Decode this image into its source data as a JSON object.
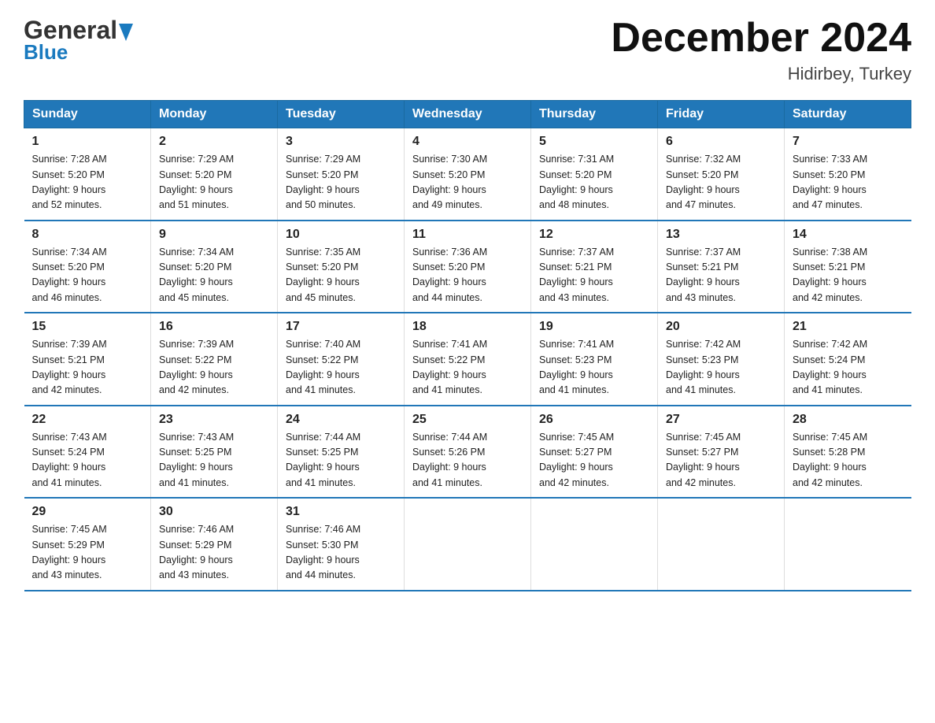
{
  "header": {
    "logo_general": "General",
    "logo_blue": "Blue",
    "month_title": "December 2024",
    "location": "Hidirbey, Turkey"
  },
  "days_of_week": [
    "Sunday",
    "Monday",
    "Tuesday",
    "Wednesday",
    "Thursday",
    "Friday",
    "Saturday"
  ],
  "weeks": [
    [
      {
        "day": "1",
        "sunrise": "7:28 AM",
        "sunset": "5:20 PM",
        "daylight": "9 hours and 52 minutes."
      },
      {
        "day": "2",
        "sunrise": "7:29 AM",
        "sunset": "5:20 PM",
        "daylight": "9 hours and 51 minutes."
      },
      {
        "day": "3",
        "sunrise": "7:29 AM",
        "sunset": "5:20 PM",
        "daylight": "9 hours and 50 minutes."
      },
      {
        "day": "4",
        "sunrise": "7:30 AM",
        "sunset": "5:20 PM",
        "daylight": "9 hours and 49 minutes."
      },
      {
        "day": "5",
        "sunrise": "7:31 AM",
        "sunset": "5:20 PM",
        "daylight": "9 hours and 48 minutes."
      },
      {
        "day": "6",
        "sunrise": "7:32 AM",
        "sunset": "5:20 PM",
        "daylight": "9 hours and 47 minutes."
      },
      {
        "day": "7",
        "sunrise": "7:33 AM",
        "sunset": "5:20 PM",
        "daylight": "9 hours and 47 minutes."
      }
    ],
    [
      {
        "day": "8",
        "sunrise": "7:34 AM",
        "sunset": "5:20 PM",
        "daylight": "9 hours and 46 minutes."
      },
      {
        "day": "9",
        "sunrise": "7:34 AM",
        "sunset": "5:20 PM",
        "daylight": "9 hours and 45 minutes."
      },
      {
        "day": "10",
        "sunrise": "7:35 AM",
        "sunset": "5:20 PM",
        "daylight": "9 hours and 45 minutes."
      },
      {
        "day": "11",
        "sunrise": "7:36 AM",
        "sunset": "5:20 PM",
        "daylight": "9 hours and 44 minutes."
      },
      {
        "day": "12",
        "sunrise": "7:37 AM",
        "sunset": "5:21 PM",
        "daylight": "9 hours and 43 minutes."
      },
      {
        "day": "13",
        "sunrise": "7:37 AM",
        "sunset": "5:21 PM",
        "daylight": "9 hours and 43 minutes."
      },
      {
        "day": "14",
        "sunrise": "7:38 AM",
        "sunset": "5:21 PM",
        "daylight": "9 hours and 42 minutes."
      }
    ],
    [
      {
        "day": "15",
        "sunrise": "7:39 AM",
        "sunset": "5:21 PM",
        "daylight": "9 hours and 42 minutes."
      },
      {
        "day": "16",
        "sunrise": "7:39 AM",
        "sunset": "5:22 PM",
        "daylight": "9 hours and 42 minutes."
      },
      {
        "day": "17",
        "sunrise": "7:40 AM",
        "sunset": "5:22 PM",
        "daylight": "9 hours and 41 minutes."
      },
      {
        "day": "18",
        "sunrise": "7:41 AM",
        "sunset": "5:22 PM",
        "daylight": "9 hours and 41 minutes."
      },
      {
        "day": "19",
        "sunrise": "7:41 AM",
        "sunset": "5:23 PM",
        "daylight": "9 hours and 41 minutes."
      },
      {
        "day": "20",
        "sunrise": "7:42 AM",
        "sunset": "5:23 PM",
        "daylight": "9 hours and 41 minutes."
      },
      {
        "day": "21",
        "sunrise": "7:42 AM",
        "sunset": "5:24 PM",
        "daylight": "9 hours and 41 minutes."
      }
    ],
    [
      {
        "day": "22",
        "sunrise": "7:43 AM",
        "sunset": "5:24 PM",
        "daylight": "9 hours and 41 minutes."
      },
      {
        "day": "23",
        "sunrise": "7:43 AM",
        "sunset": "5:25 PM",
        "daylight": "9 hours and 41 minutes."
      },
      {
        "day": "24",
        "sunrise": "7:44 AM",
        "sunset": "5:25 PM",
        "daylight": "9 hours and 41 minutes."
      },
      {
        "day": "25",
        "sunrise": "7:44 AM",
        "sunset": "5:26 PM",
        "daylight": "9 hours and 41 minutes."
      },
      {
        "day": "26",
        "sunrise": "7:45 AM",
        "sunset": "5:27 PM",
        "daylight": "9 hours and 42 minutes."
      },
      {
        "day": "27",
        "sunrise": "7:45 AM",
        "sunset": "5:27 PM",
        "daylight": "9 hours and 42 minutes."
      },
      {
        "day": "28",
        "sunrise": "7:45 AM",
        "sunset": "5:28 PM",
        "daylight": "9 hours and 42 minutes."
      }
    ],
    [
      {
        "day": "29",
        "sunrise": "7:45 AM",
        "sunset": "5:29 PM",
        "daylight": "9 hours and 43 minutes."
      },
      {
        "day": "30",
        "sunrise": "7:46 AM",
        "sunset": "5:29 PM",
        "daylight": "9 hours and 43 minutes."
      },
      {
        "day": "31",
        "sunrise": "7:46 AM",
        "sunset": "5:30 PM",
        "daylight": "9 hours and 44 minutes."
      },
      {
        "day": "",
        "sunrise": "",
        "sunset": "",
        "daylight": ""
      },
      {
        "day": "",
        "sunrise": "",
        "sunset": "",
        "daylight": ""
      },
      {
        "day": "",
        "sunrise": "",
        "sunset": "",
        "daylight": ""
      },
      {
        "day": "",
        "sunrise": "",
        "sunset": "",
        "daylight": ""
      }
    ]
  ]
}
